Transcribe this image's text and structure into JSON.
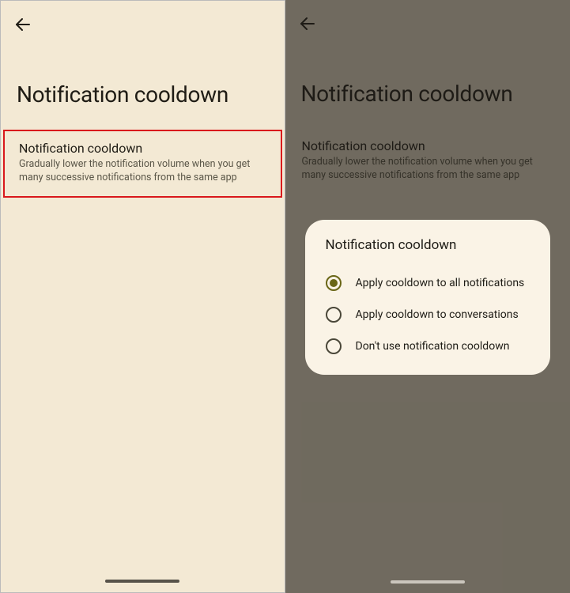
{
  "left": {
    "pageTitle": "Notification cooldown",
    "setting": {
      "title": "Notification cooldown",
      "description": "Gradually lower the notification volume when you get many successive notifications from the same app"
    }
  },
  "right": {
    "pageTitle": "Notification cooldown",
    "setting": {
      "title": "Notification cooldown",
      "description": "Gradually lower the notification volume when you get many successive notifications from the same app"
    },
    "dialog": {
      "title": "Notification cooldown",
      "options": [
        {
          "label": "Apply cooldown to all notifications",
          "selected": true
        },
        {
          "label": "Apply cooldown to conversations",
          "selected": false
        },
        {
          "label": "Don't use notification cooldown",
          "selected": false
        }
      ]
    }
  }
}
